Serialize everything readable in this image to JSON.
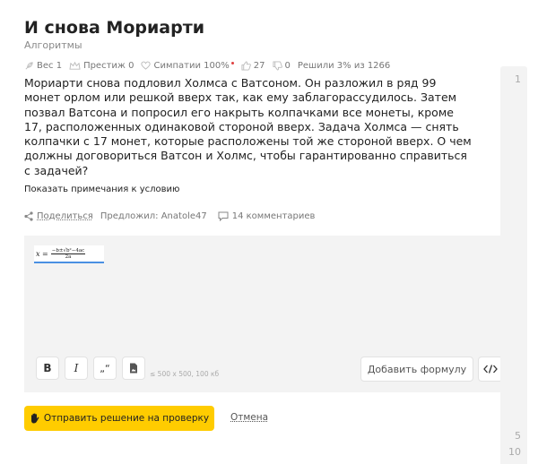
{
  "problem": {
    "title": "И снова Мориарти",
    "category": "Алгоритмы",
    "statement": "Мориарти снова подловил Холмса с Ватсоном. Он разложил в ряд 99 монет орлом или решкой вверх так, как ему заблагорассудилось. Затем позвал Ватсона и попросил его накрыть колпачками все монеты, кроме 17, расположенных одинаковой стороной вверх. Задача Холмса — снять колпачки с 17 монет, которые расположены той же стороной вверх. О чем должны договориться Ватсон и Холмс, чтобы гарантированно справиться с задачей?",
    "notes_link": "Показать примечания к условию"
  },
  "stats": {
    "weight": "Вес 1",
    "prestige": "Престиж 0",
    "sympathy": "Симпатии 100%",
    "likes": "27",
    "dislikes": "0",
    "solved": "Решили 3% из 1266"
  },
  "meta": {
    "share": "Поделиться",
    "author": "Предложил: Anatole47",
    "comments": "14 комментариев"
  },
  "editor": {
    "formula_lhs": "x =",
    "formula_num": "−b±√b²−4ac",
    "formula_den": "2a",
    "bold": "B",
    "italic": "I",
    "quote": "„“",
    "image_hint": "≤ 500 x 500, 100 кб",
    "add_formula": "Добавить формулу"
  },
  "actions": {
    "submit": "Отправить решение на проверку",
    "cancel": "Отмена"
  },
  "gutter": {
    "line_1": "1",
    "line_5": "5",
    "line_10": "10"
  },
  "colors": {
    "accent": "#ffcc00",
    "formula_border": "#4a90e2",
    "dot": "#e04040"
  }
}
